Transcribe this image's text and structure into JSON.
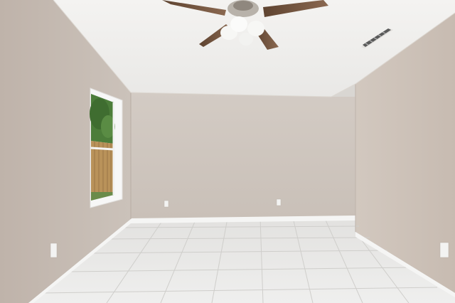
{
  "scene": {
    "colors": {
      "ceiling": "#f2f1ef",
      "back_wall": "#cfc6be",
      "left_wall": "#c6bbb3",
      "right_wall": "#cbbfb6",
      "floor": "#e7e6e4",
      "baseboard": "#f4f4f3",
      "fan_blade": "#7a5a44",
      "fan_light": "#f7f7f5",
      "window_trim": "#f7f7f7",
      "window_sky": "#dfe9f2",
      "fence": "#b9925a",
      "foliage": "#4c7d3a"
    },
    "icons": {
      "ceiling_fan": "ceiling-fan-icon",
      "vent": "air-vent-icon",
      "outlet": "outlet-icon"
    }
  }
}
